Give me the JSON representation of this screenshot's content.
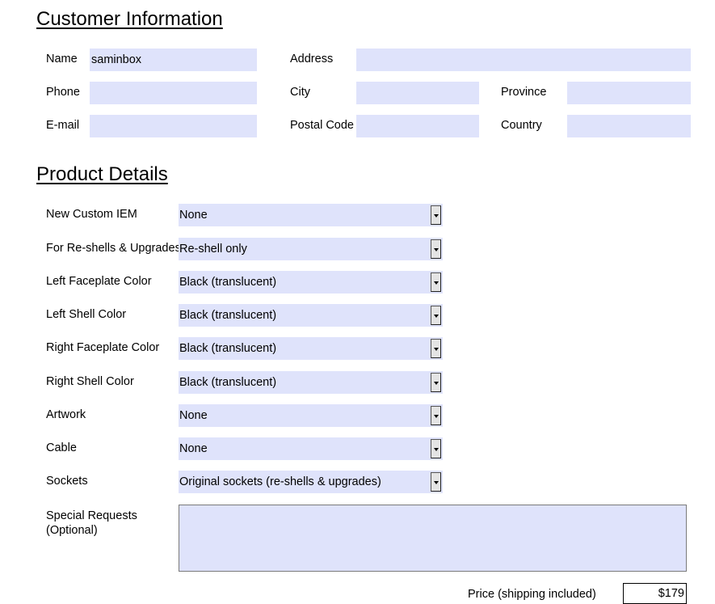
{
  "customer_section": {
    "title": "Customer Information",
    "name_label": "Name",
    "name_value": "saminbox",
    "address_label": "Address",
    "address_value": "",
    "phone_label": "Phone",
    "phone_value": "",
    "city_label": "City",
    "city_value": "",
    "province_label": "Province",
    "province_value": "",
    "email_label": "E-mail",
    "email_value": "",
    "postal_label": "Postal Code",
    "postal_value": "",
    "country_label": "Country",
    "country_value": ""
  },
  "product_section": {
    "title": "Product Details",
    "rows": [
      {
        "label": "New Custom IEM",
        "value": "None"
      },
      {
        "label": "For Re-shells & Upgrades",
        "value": "Re-shell only"
      },
      {
        "label": "Left Faceplate Color",
        "value": "Black (translucent)"
      },
      {
        "label": "Left Shell Color",
        "value": "Black (translucent)"
      },
      {
        "label": "Right Faceplate Color",
        "value": "Black (translucent)"
      },
      {
        "label": "Right Shell Color",
        "value": "Black (translucent)"
      },
      {
        "label": "Artwork",
        "value": "None"
      },
      {
        "label": "Cable",
        "value": "None"
      },
      {
        "label": "Sockets",
        "value": "Original sockets (re-shells & upgrades)"
      }
    ],
    "special_requests_label_line1": "Special Requests",
    "special_requests_label_line2": "(Optional)",
    "special_requests_value": ""
  },
  "price": {
    "label": "Price (shipping included)",
    "value": "$179"
  },
  "colors": {
    "field_bg": "#dfe3fb"
  }
}
